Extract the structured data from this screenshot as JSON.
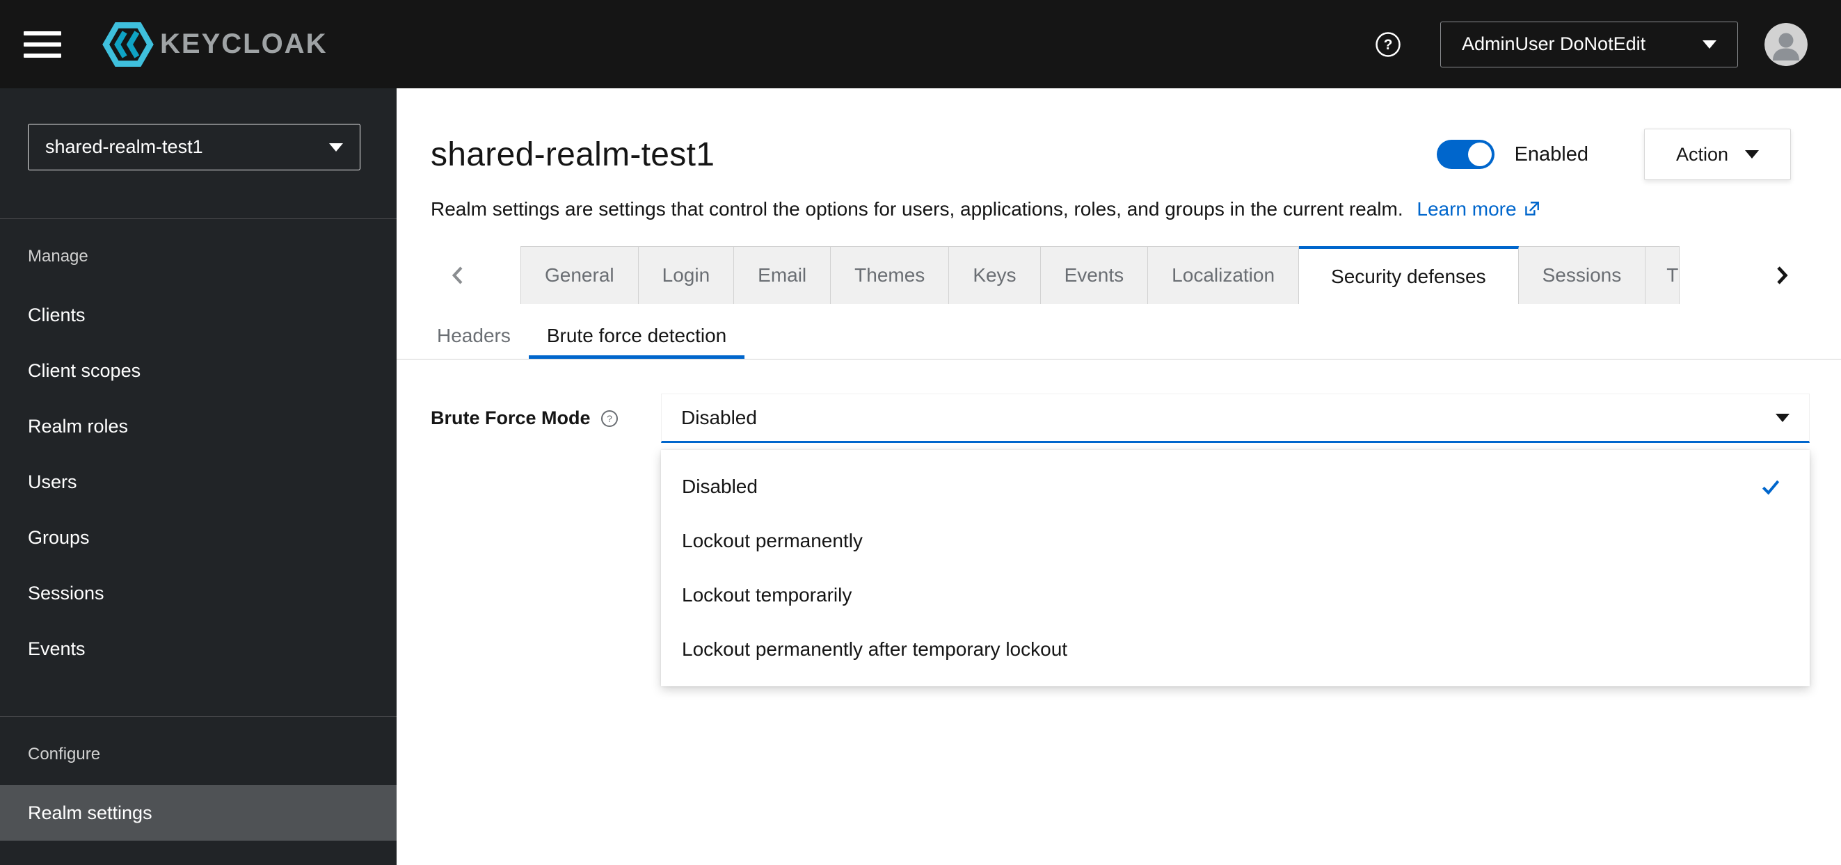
{
  "header": {
    "brand": "KEYCLOAK",
    "user_menu_label": "AdminUser DoNotEdit"
  },
  "sidebar": {
    "realm": "shared-realm-test1",
    "manage_label": "Manage",
    "manage_items": [
      "Clients",
      "Client scopes",
      "Realm roles",
      "Users",
      "Groups",
      "Sessions",
      "Events"
    ],
    "configure_label": "Configure",
    "configure_items": [
      "Realm settings"
    ],
    "selected_item": "Realm settings"
  },
  "main": {
    "title": "shared-realm-test1",
    "enabled": true,
    "enabled_label": "Enabled",
    "action_label": "Action",
    "description": "Realm settings are settings that control the options for users, applications, roles, and groups in the current realm.",
    "learn_more_label": "Learn more",
    "tabs": [
      "General",
      "Login",
      "Email",
      "Themes",
      "Keys",
      "Events",
      "Localization",
      "Security defenses",
      "Sessions",
      "T"
    ],
    "active_tab": "Security defenses",
    "subtabs": [
      "Headers",
      "Brute force detection"
    ],
    "active_subtab": "Brute force detection",
    "form": {
      "label": "Brute Force Mode",
      "value": "Disabled",
      "options": [
        "Disabled",
        "Lockout permanently",
        "Lockout temporarily",
        "Lockout permanently after temporary lockout"
      ],
      "selected_option": "Disabled"
    }
  },
  "colors": {
    "accent": "#0066cc",
    "header_bg": "#151515",
    "sidebar_bg": "#212427",
    "selected_nav_bg": "#4f5255",
    "link": "#0066cc",
    "toggle_on": "#0066cc"
  }
}
